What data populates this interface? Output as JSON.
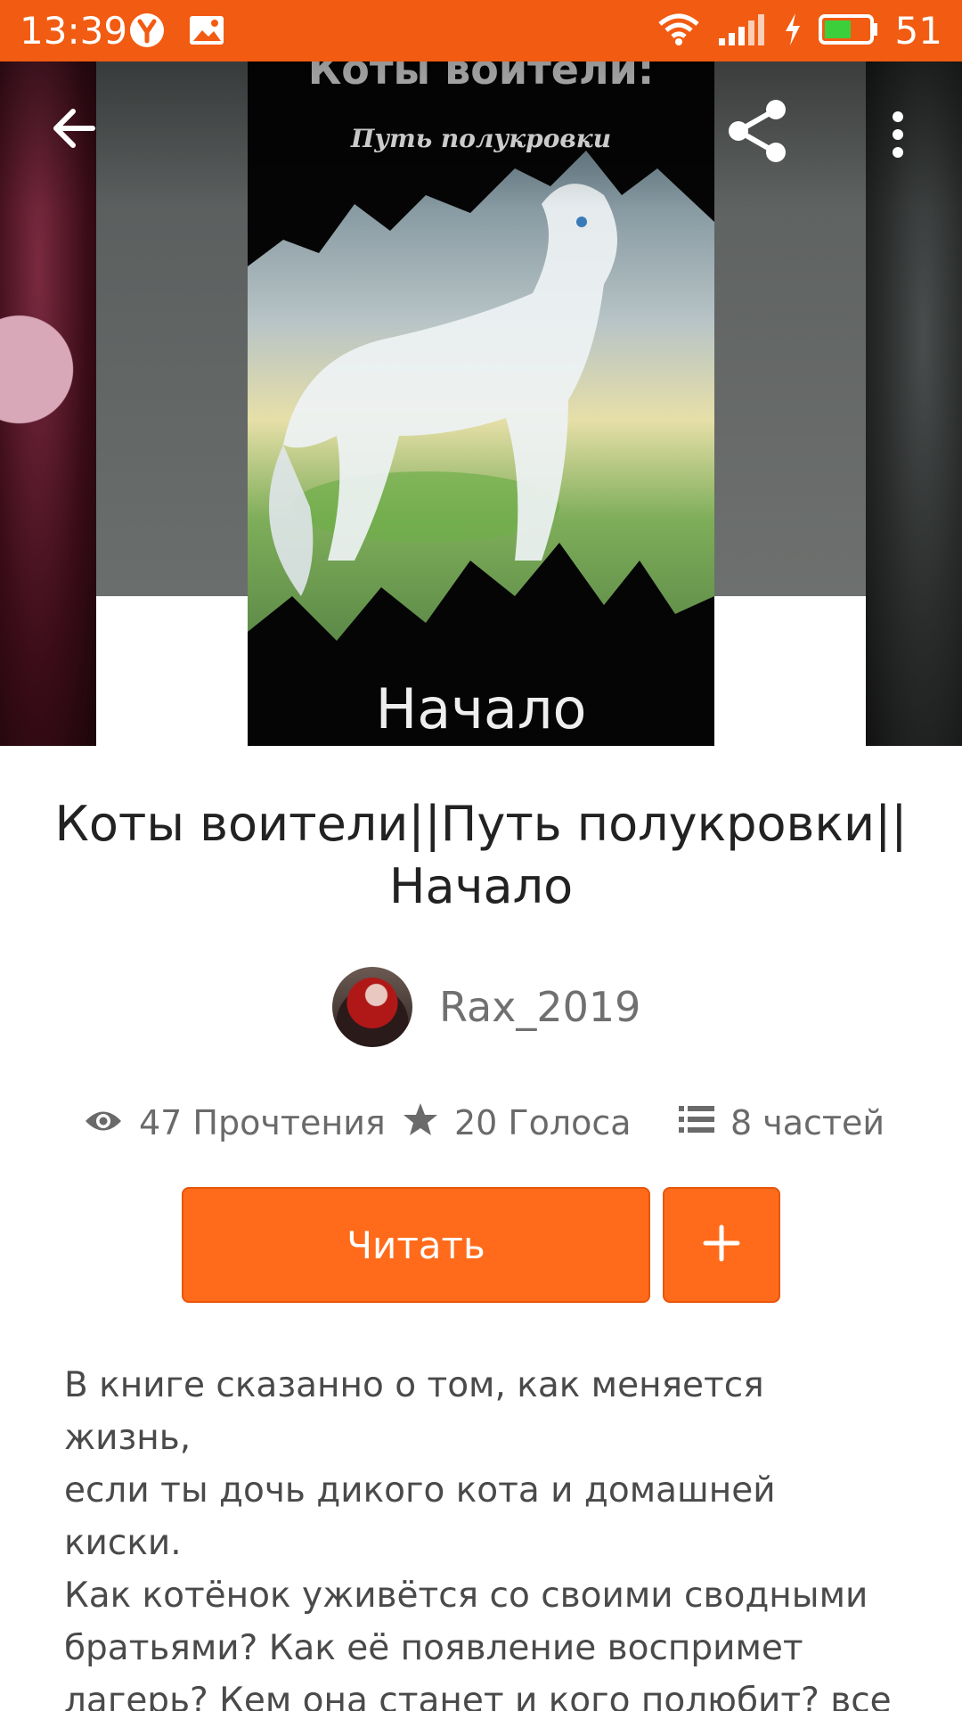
{
  "status_bar": {
    "time": "13:39",
    "battery": "51",
    "icons": [
      "yandex-icon",
      "image-notification-icon",
      "wifi-icon",
      "signal-icon",
      "charging-icon",
      "battery-icon"
    ]
  },
  "toolbar": {
    "back_icon": "back-arrow-icon",
    "share_icon": "share-icon",
    "more_icon": "more-vert-icon"
  },
  "cover": {
    "title": "Коты воители:",
    "subtitle": "Путь полукровки",
    "bottom_word": "Начало"
  },
  "book": {
    "title": "Коты воители||Путь полукровки|| Начало",
    "author": "Rax_2019"
  },
  "stats": {
    "reads": "47 Прочтения",
    "votes": "20 Голоса",
    "parts": "8 частей"
  },
  "actions": {
    "read_label": "Читать",
    "add_label": "+"
  },
  "description": "В книге сказанно о том, как меняется жизнь,\nесли ты дочь дикого кота и домашней киски.\nКак котёнок уживётся со своими сводными\nбратьями? Как её появление воспримет\nлагерь?  Кем она станет и кого полюбит? все\nответы в книге!",
  "colors": {
    "accent": "#ff6b1a",
    "status_bar": "#f25b12",
    "title_text": "#222222",
    "secondary_text": "#6a6a6a"
  }
}
